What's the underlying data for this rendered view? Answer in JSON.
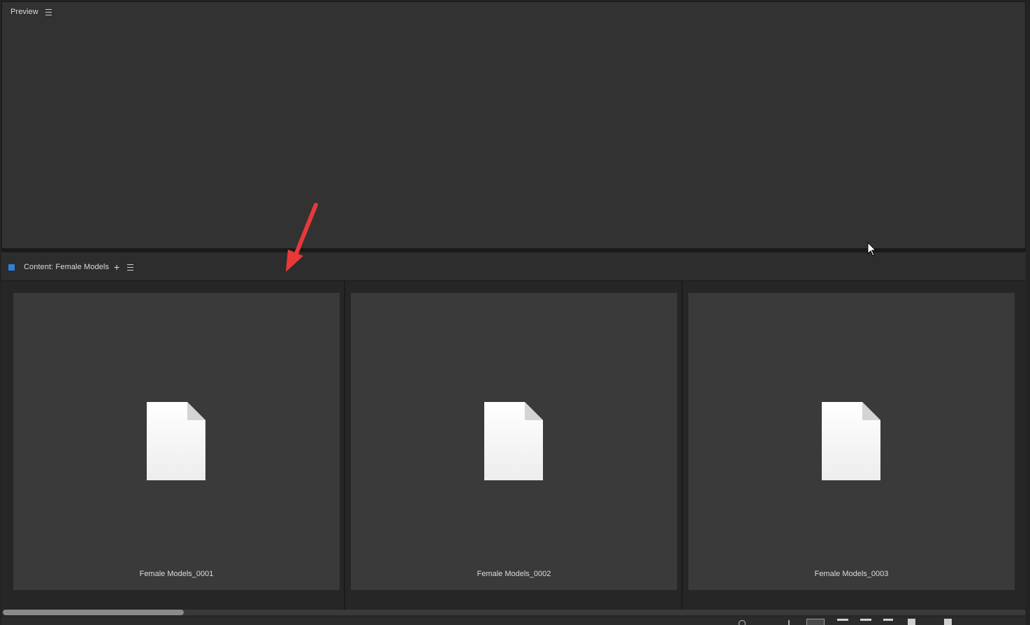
{
  "preview_panel": {
    "title": "Preview",
    "menu_icon": "hamburger-menu-icon"
  },
  "content_panel": {
    "title": "Content: Female Models",
    "color_label": "#2f7fe0",
    "add_icon": "plus-icon",
    "menu_icon": "hamburger-menu-icon",
    "items": [
      {
        "label": "Female Models_0001",
        "icon": "generic-document-icon"
      },
      {
        "label": "Female Models_0002",
        "icon": "generic-document-icon"
      },
      {
        "label": "Female Models_0003",
        "icon": "generic-document-icon"
      }
    ],
    "scrollbar": {
      "position": 0,
      "visible_fraction": 0.18
    }
  },
  "annotation": {
    "icon": "red-arrow-icon",
    "color": "#e8393a"
  },
  "cursor": {
    "icon": "mouse-pointer-icon"
  },
  "colors": {
    "panel_bg": "#323232",
    "tile_bg": "#3a3a3a",
    "accent_blue": "#2f7fe0"
  }
}
